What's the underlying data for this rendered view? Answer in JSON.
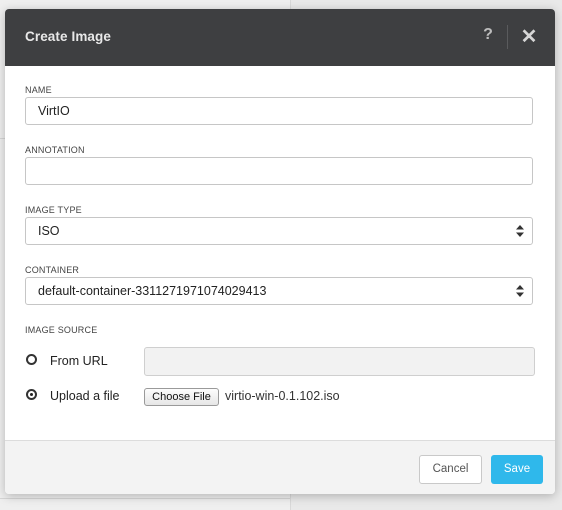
{
  "dialog": {
    "title": "Create Image",
    "help_label": "?",
    "close_label": "✕"
  },
  "form": {
    "name_label": "NAME",
    "name_value": "VirtIO",
    "annotation_label": "ANNOTATION",
    "annotation_value": "",
    "image_type_label": "IMAGE TYPE",
    "image_type_value": "ISO",
    "container_label": "CONTAINER",
    "container_value": "default-container-3311271971074029413",
    "image_source_label": "IMAGE SOURCE",
    "source_options": [
      {
        "label": "From URL",
        "selected": false
      },
      {
        "label": "Upload a file",
        "selected": true
      }
    ],
    "url_value": "",
    "choose_file_label": "Choose File",
    "file_name": "virtio-win-0.1.102.iso"
  },
  "footer": {
    "cancel_label": "Cancel",
    "save_label": "Save"
  },
  "colors": {
    "header_bg": "#3e3f41",
    "accent": "#2fb8eb"
  }
}
